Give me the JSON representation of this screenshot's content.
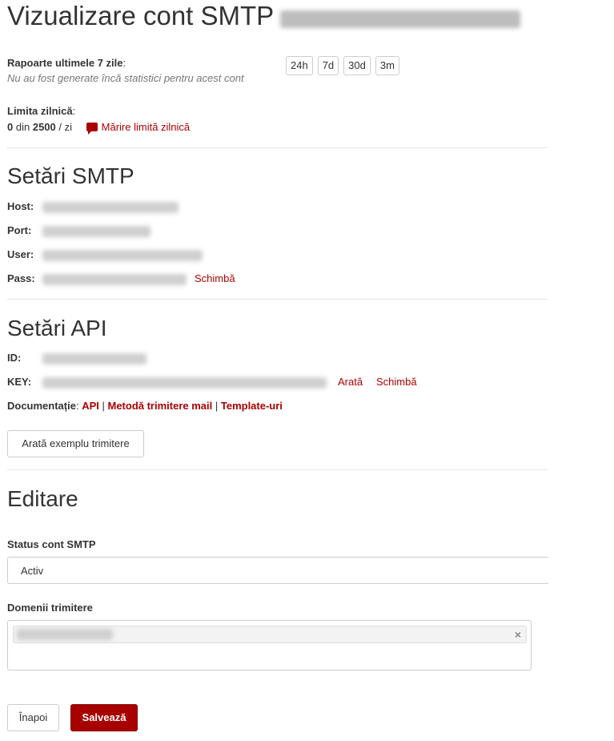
{
  "header": {
    "title": "Vizualizare cont SMTP"
  },
  "reports": {
    "label": "Rapoarte ultimele 7 zile",
    "note": "Nu au fost generate încă statistici pentru acest cont",
    "ranges": [
      "24h",
      "7d",
      "30d",
      "3m"
    ]
  },
  "limit": {
    "label": "Limita zilnică",
    "used": "0",
    "of": "din",
    "total": "2500",
    "per": "/ zi",
    "increase_link": "Mărire limită zilnică"
  },
  "smtp": {
    "heading": "Setări SMTP",
    "host_label": "Host:",
    "port_label": "Port:",
    "user_label": "User:",
    "pass_label": "Pass:",
    "change_link": "Schimbă"
  },
  "api": {
    "heading": "Setări API",
    "id_label": "ID:",
    "key_label": "KEY:",
    "show_link": "Arată",
    "change_link": "Schimbă",
    "docs_label": "Documentație",
    "docs_links": [
      "API",
      "Metodă trimitere mail",
      "Template-uri"
    ],
    "example_button": "Arată exemplu trimitere"
  },
  "edit": {
    "heading": "Editare",
    "status_label": "Status cont SMTP",
    "status_value": "Activ",
    "domains_label": "Domenii trimitere",
    "remove_symbol": "×"
  },
  "footer": {
    "back_button": "Înapoi",
    "save_button": "Salvează"
  },
  "colors": {
    "accent": "#a70000",
    "link": "#aa0000"
  }
}
